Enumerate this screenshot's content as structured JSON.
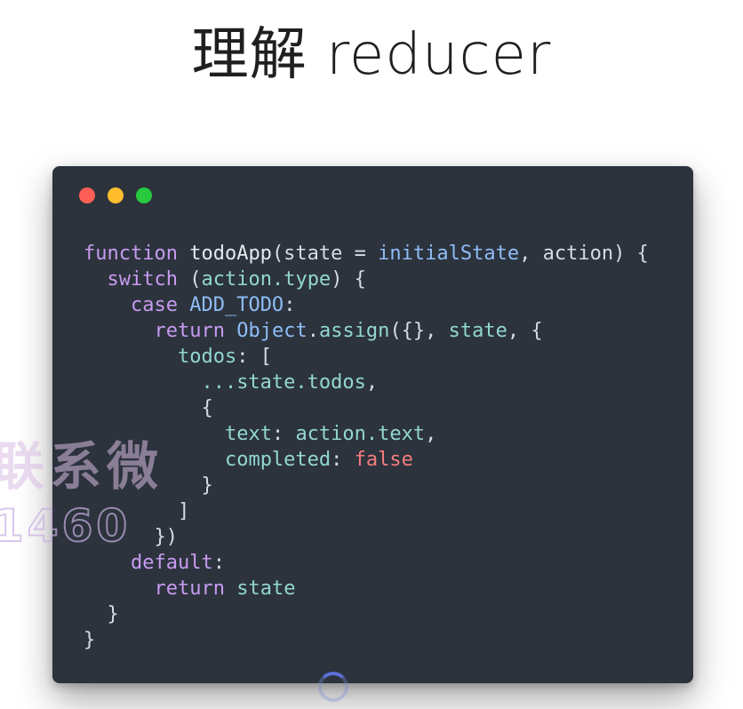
{
  "slide": {
    "title": "理解 reducer"
  },
  "code_window": {
    "traffic_lights": [
      "red",
      "yellow",
      "green"
    ],
    "colors": {
      "background": "#2c333d",
      "keyword": "#c79bf0",
      "identifier": "#8fbcf5",
      "property": "#92d6d0",
      "boolean": "#f47c7c",
      "plain": "#d6dbe4"
    },
    "lines": [
      [
        {
          "t": "kw",
          "v": "function"
        },
        {
          "t": "fn",
          "v": " todoApp"
        },
        {
          "t": "pl",
          "v": "(state = "
        },
        {
          "t": "id",
          "v": "initialState"
        },
        {
          "t": "pl",
          "v": ", action) {"
        }
      ],
      [
        {
          "t": "pl",
          "v": "  "
        },
        {
          "t": "kw",
          "v": "switch"
        },
        {
          "t": "pl",
          "v": " ("
        },
        {
          "t": "prop",
          "v": "action.type"
        },
        {
          "t": "pl",
          "v": ") {"
        }
      ],
      [
        {
          "t": "pl",
          "v": "    "
        },
        {
          "t": "kw",
          "v": "case"
        },
        {
          "t": "pl",
          "v": " "
        },
        {
          "t": "id",
          "v": "ADD_TODO"
        },
        {
          "t": "pl",
          "v": ":"
        }
      ],
      [
        {
          "t": "pl",
          "v": "      "
        },
        {
          "t": "kw",
          "v": "return"
        },
        {
          "t": "pl",
          "v": " "
        },
        {
          "t": "id",
          "v": "Object"
        },
        {
          "t": "pl",
          "v": "."
        },
        {
          "t": "prop",
          "v": "assign"
        },
        {
          "t": "pl",
          "v": "({}, "
        },
        {
          "t": "prop",
          "v": "state"
        },
        {
          "t": "pl",
          "v": ", {"
        }
      ],
      [
        {
          "t": "pl",
          "v": "        "
        },
        {
          "t": "prop",
          "v": "todos"
        },
        {
          "t": "pl",
          "v": ": ["
        }
      ],
      [
        {
          "t": "pl",
          "v": "          "
        },
        {
          "t": "prop",
          "v": "...state.todos"
        },
        {
          "t": "pl",
          "v": ","
        }
      ],
      [
        {
          "t": "pl",
          "v": "          {"
        }
      ],
      [
        {
          "t": "pl",
          "v": "            "
        },
        {
          "t": "prop",
          "v": "text"
        },
        {
          "t": "pl",
          "v": ": "
        },
        {
          "t": "prop",
          "v": "action.text"
        },
        {
          "t": "pl",
          "v": ","
        }
      ],
      [
        {
          "t": "pl",
          "v": "            "
        },
        {
          "t": "prop",
          "v": "completed"
        },
        {
          "t": "pl",
          "v": ": "
        },
        {
          "t": "bool",
          "v": "false"
        }
      ],
      [
        {
          "t": "pl",
          "v": "          }"
        }
      ],
      [
        {
          "t": "pl",
          "v": "        ]"
        }
      ],
      [
        {
          "t": "pl",
          "v": "      })"
        }
      ],
      [
        {
          "t": "pl",
          "v": "    "
        },
        {
          "t": "kw",
          "v": "default"
        },
        {
          "t": "pl",
          "v": ":"
        }
      ],
      [
        {
          "t": "pl",
          "v": "      "
        },
        {
          "t": "kw",
          "v": "return"
        },
        {
          "t": "pl",
          "v": " "
        },
        {
          "t": "prop",
          "v": "state"
        }
      ],
      [
        {
          "t": "pl",
          "v": "  }"
        }
      ],
      [
        {
          "t": "pl",
          "v": "}"
        }
      ]
    ]
  },
  "watermark": {
    "line1": "联系微",
    "line2": "1460"
  },
  "loading_indicator": {
    "icon": "spinner-icon"
  }
}
